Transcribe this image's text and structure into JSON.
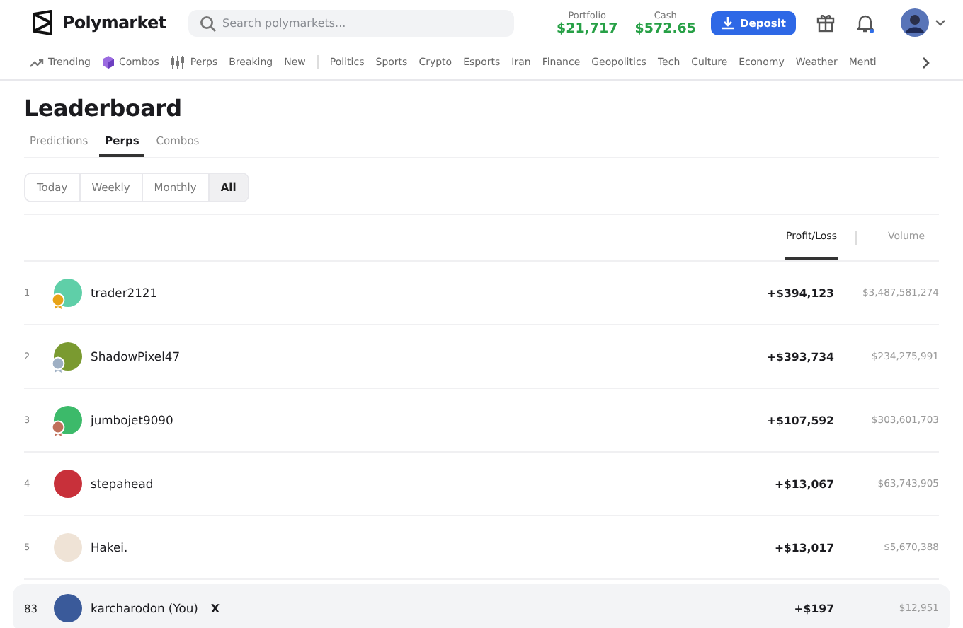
{
  "brand": "Polymarket",
  "search": {
    "placeholder": "Search polymarkets..."
  },
  "portfolio": {
    "label": "Portfolio",
    "value": "$21,717"
  },
  "cash": {
    "label": "Cash",
    "value": "$572.65"
  },
  "deposit_button": "Deposit",
  "categories": [
    {
      "label": "Trending",
      "kind": "trending"
    },
    {
      "label": "Combos",
      "kind": "combos"
    },
    {
      "label": "Perps",
      "kind": "perps"
    },
    {
      "label": "Breaking",
      "kind": "plain"
    },
    {
      "label": "New",
      "kind": "plain"
    },
    {
      "kind": "divider"
    },
    {
      "label": "Politics",
      "kind": "plain"
    },
    {
      "label": "Sports",
      "kind": "plain"
    },
    {
      "label": "Crypto",
      "kind": "plain"
    },
    {
      "label": "Esports",
      "kind": "plain"
    },
    {
      "label": "Iran",
      "kind": "plain"
    },
    {
      "label": "Finance",
      "kind": "plain"
    },
    {
      "label": "Geopolitics",
      "kind": "plain"
    },
    {
      "label": "Tech",
      "kind": "plain"
    },
    {
      "label": "Culture",
      "kind": "plain"
    },
    {
      "label": "Economy",
      "kind": "plain"
    },
    {
      "label": "Weather",
      "kind": "plain"
    },
    {
      "label": "Menti",
      "kind": "plain"
    }
  ],
  "title": "Leaderboard",
  "tabs": [
    {
      "label": "Predictions",
      "selected": false
    },
    {
      "label": "Perps",
      "selected": true
    },
    {
      "label": "Combos",
      "selected": false
    }
  ],
  "periods": [
    {
      "label": "Today",
      "selected": false
    },
    {
      "label": "Weekly",
      "selected": false
    },
    {
      "label": "Monthly",
      "selected": false
    },
    {
      "label": "All",
      "selected": true
    }
  ],
  "columns": [
    {
      "label": "Profit/Loss",
      "selected": true
    },
    {
      "label": "Volume",
      "selected": false
    }
  ],
  "rows": [
    {
      "rank": "1",
      "name": "trader2121",
      "medal": {
        "color": "#e8a317"
      },
      "avatar": {
        "color": "#5fcfa8"
      },
      "pnl": "+$394,123",
      "volume": "$3,487,581,274",
      "you": false
    },
    {
      "rank": "2",
      "name": "ShadowPixel47",
      "medal": {
        "color": "#9fb0c4"
      },
      "avatar": {
        "color": "#7a9a30"
      },
      "pnl": "+$393,734",
      "volume": "$234,275,991",
      "you": false
    },
    {
      "rank": "3",
      "name": "jumbojet9090",
      "medal": {
        "color": "#c0705a"
      },
      "avatar": {
        "color": "#3cba6a"
      },
      "pnl": "+$107,592",
      "volume": "$303,601,703",
      "you": false
    },
    {
      "rank": "4",
      "name": "stepahead",
      "avatar": {
        "color": "#c8303a"
      },
      "pnl": "+$13,067",
      "volume": "$63,743,905",
      "you": false
    },
    {
      "rank": "5",
      "name": "Hakei.",
      "avatar": {
        "color": "#efe3d6"
      },
      "pnl": "+$13,017",
      "volume": "$5,670,388",
      "you": false
    },
    {
      "rank": "83",
      "name": "karcharodon (You)",
      "avatar": {
        "color": "#3a5a9a"
      },
      "pnl": "+$197",
      "volume": "$12,951",
      "you": true,
      "x_link": "X"
    }
  ]
}
